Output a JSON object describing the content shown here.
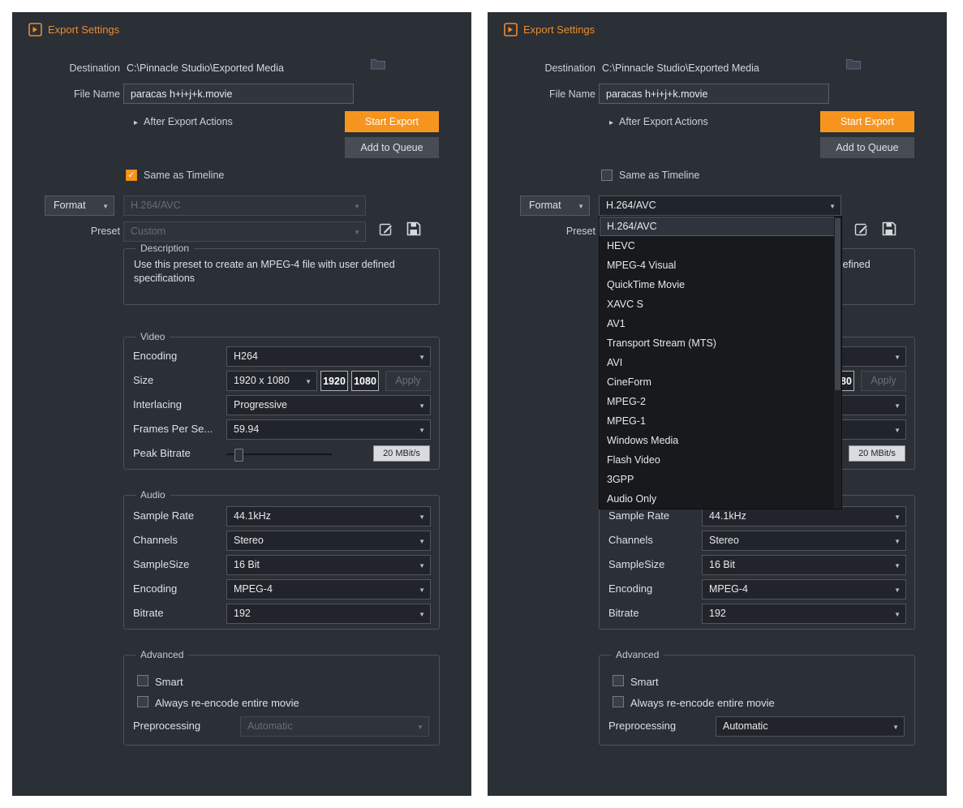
{
  "icons": {
    "chevron": "▼",
    "expand": "▸"
  },
  "colors": {
    "accent": "#f7941e",
    "panel_bg": "#2b2f36",
    "dropdown_bg": "#17191d"
  },
  "panels": {
    "left": {
      "title": "Export Settings",
      "destination": {
        "label": "Destination",
        "value": "C:\\Pinnacle Studio\\Exported Media"
      },
      "file_name": {
        "label": "File Name",
        "value": "paracas h+i+j+k.movie"
      },
      "after_export_actions": "After Export Actions",
      "start_export": "Start Export",
      "add_to_queue": "Add to Queue",
      "same_as_timeline": {
        "label": "Same as Timeline",
        "checked": true
      },
      "format": {
        "label": "Format",
        "value": "H.264/AVC",
        "disabled": true
      },
      "preset": {
        "label": "Preset",
        "value": "Custom",
        "disabled": true
      },
      "description": {
        "legend": "Description",
        "text": "Use this preset to create an MPEG-4 file with user defined specifications"
      },
      "video": {
        "legend": "Video",
        "encoding": {
          "label": "Encoding",
          "value": "H264"
        },
        "size": {
          "label": "Size",
          "preset": "1920 x 1080",
          "width": "1920",
          "height": "1080",
          "apply": "Apply"
        },
        "interlacing": {
          "label": "Interlacing",
          "value": "Progressive"
        },
        "frames": {
          "label": "Frames Per Se...",
          "value": "59.94"
        },
        "peak_bitrate": {
          "label": "Peak Bitrate",
          "value": "20 MBit/s"
        }
      },
      "audio": {
        "legend": "Audio",
        "rows": [
          {
            "label": "Sample Rate",
            "value": "44.1kHz"
          },
          {
            "label": "Channels",
            "value": "Stereo"
          },
          {
            "label": "SampleSize",
            "value": "16 Bit"
          },
          {
            "label": "Encoding",
            "value": "MPEG-4"
          },
          {
            "label": "Bitrate",
            "value": "192"
          }
        ]
      },
      "advanced": {
        "legend": "Advanced",
        "smart": {
          "label": "Smart",
          "checked": false
        },
        "reencode": {
          "label": "Always re-encode entire movie",
          "checked": false
        },
        "preprocessing": {
          "label": "Preprocessing",
          "value": "Automatic",
          "disabled": true
        }
      }
    },
    "right": {
      "title": "Export Settings",
      "destination": {
        "label": "Destination",
        "value": "C:\\Pinnacle Studio\\Exported Media"
      },
      "file_name": {
        "label": "File Name",
        "value": "paracas h+i+j+k.movie"
      },
      "after_export_actions": "After Export Actions",
      "start_export": "Start Export",
      "add_to_queue": "Add to Queue",
      "same_as_timeline": {
        "label": "Same as Timeline",
        "checked": false
      },
      "format": {
        "label": "Format",
        "value": "H.264/AVC",
        "disabled": false
      },
      "preset": {
        "label": "Preset",
        "value": "Custom",
        "disabled": true
      },
      "format_dropdown": {
        "selected_index": 0,
        "options": [
          "H.264/AVC",
          "HEVC",
          "MPEG-4 Visual",
          "QuickTime Movie",
          "XAVC S",
          "AV1",
          "Transport Stream (MTS)",
          "AVI",
          "CineForm",
          "MPEG-2",
          "MPEG-1",
          "Windows Media",
          "Flash Video",
          "3GPP",
          "Audio Only"
        ]
      },
      "description": {
        "legend": "Description",
        "text": "Use this preset to create an MPEG-4 file with user defined specifications"
      },
      "video": {
        "legend": "Video",
        "encoding": {
          "label": "Encoding",
          "value": "H264"
        },
        "size": {
          "label": "Size",
          "preset": "1920 x 1080",
          "width": "1920",
          "height": "1080",
          "apply": "Apply"
        },
        "interlacing": {
          "label": "Interlacing",
          "value": "Progressive"
        },
        "frames": {
          "label": "Frames Per Se...",
          "value": "59.94"
        },
        "peak_bitrate": {
          "label": "Peak Bitrate",
          "value": "20 MBit/s"
        }
      },
      "audio": {
        "legend": "Audio",
        "rows": [
          {
            "label": "Sample Rate",
            "value": "44.1kHz"
          },
          {
            "label": "Channels",
            "value": "Stereo"
          },
          {
            "label": "SampleSize",
            "value": "16 Bit"
          },
          {
            "label": "Encoding",
            "value": "MPEG-4"
          },
          {
            "label": "Bitrate",
            "value": "192"
          }
        ]
      },
      "advanced": {
        "legend": "Advanced",
        "smart": {
          "label": "Smart",
          "checked": false
        },
        "reencode": {
          "label": "Always re-encode entire movie",
          "checked": false
        },
        "preprocessing": {
          "label": "Preprocessing",
          "value": "Automatic",
          "disabled": false
        }
      }
    }
  }
}
